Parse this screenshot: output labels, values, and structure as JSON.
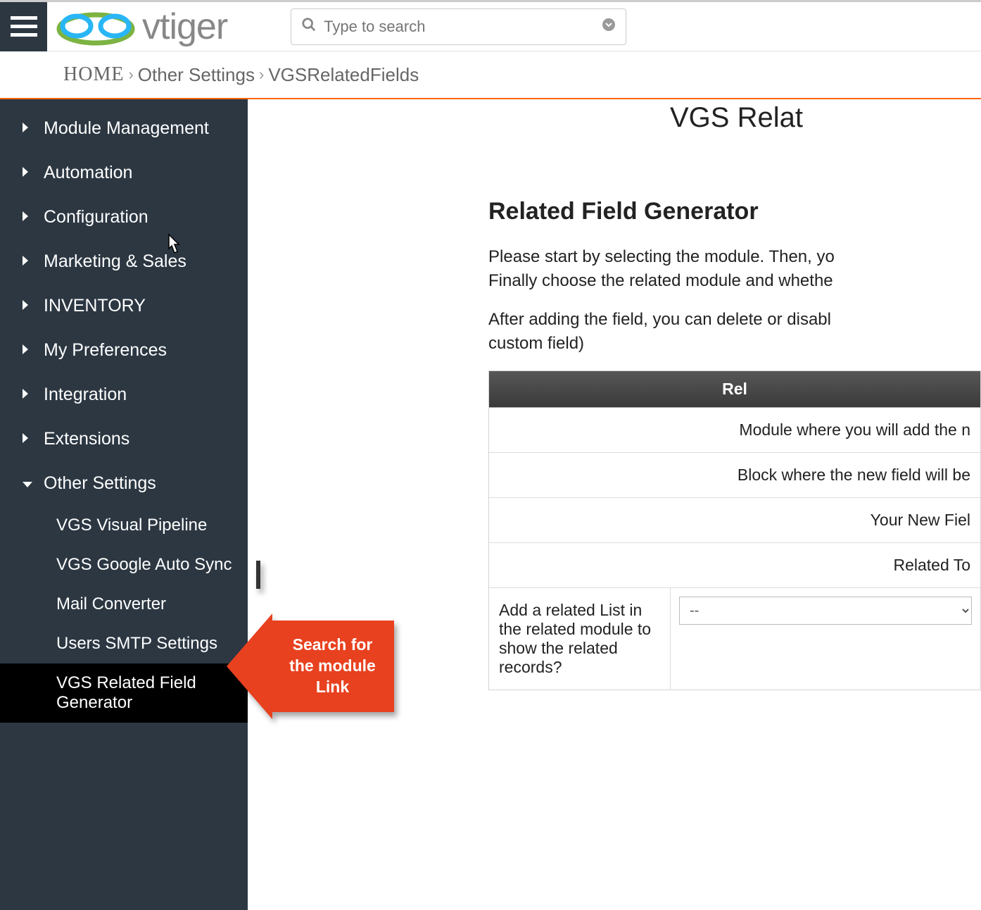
{
  "header": {
    "logo_text": "vtiger",
    "search_placeholder": "Type to search"
  },
  "breadcrumb": {
    "home": "HOME",
    "items": [
      "Other Settings",
      "VGSRelatedFields"
    ]
  },
  "sidebar": {
    "items": [
      {
        "label": "Module Management",
        "expanded": false
      },
      {
        "label": "Automation",
        "expanded": false
      },
      {
        "label": "Configuration",
        "expanded": false
      },
      {
        "label": "Marketing & Sales",
        "expanded": false
      },
      {
        "label": "INVENTORY",
        "expanded": false
      },
      {
        "label": "My Preferences",
        "expanded": false
      },
      {
        "label": "Integration",
        "expanded": false
      },
      {
        "label": "Extensions",
        "expanded": false
      },
      {
        "label": "Other Settings",
        "expanded": true
      }
    ],
    "subitems": [
      {
        "label": "VGS Visual Pipeline",
        "active": false
      },
      {
        "label": "VGS Google Auto Sync",
        "active": false
      },
      {
        "label": "Mail Converter",
        "active": false
      },
      {
        "label": "Users SMTP Settings",
        "active": false
      },
      {
        "label": "VGS Related Field Generator",
        "active": true
      }
    ]
  },
  "main": {
    "page_title": "VGS Relat",
    "section_heading": "Related Field Generator",
    "desc1": "Please start by selecting the module. Then, yo",
    "desc2": "Finally choose the related module and whethe",
    "desc3": "After adding the field, you can delete or disabl",
    "desc4": "custom field)",
    "table_header": "Rel",
    "rows": [
      "Module where you will add the n",
      "Block where the new field will be",
      "Your New Fiel",
      "Related To "
    ],
    "add_related_label": "Add a related List in the related module to show the related records?",
    "select_value": "--"
  },
  "callout": {
    "text": "Search for the module Link"
  }
}
